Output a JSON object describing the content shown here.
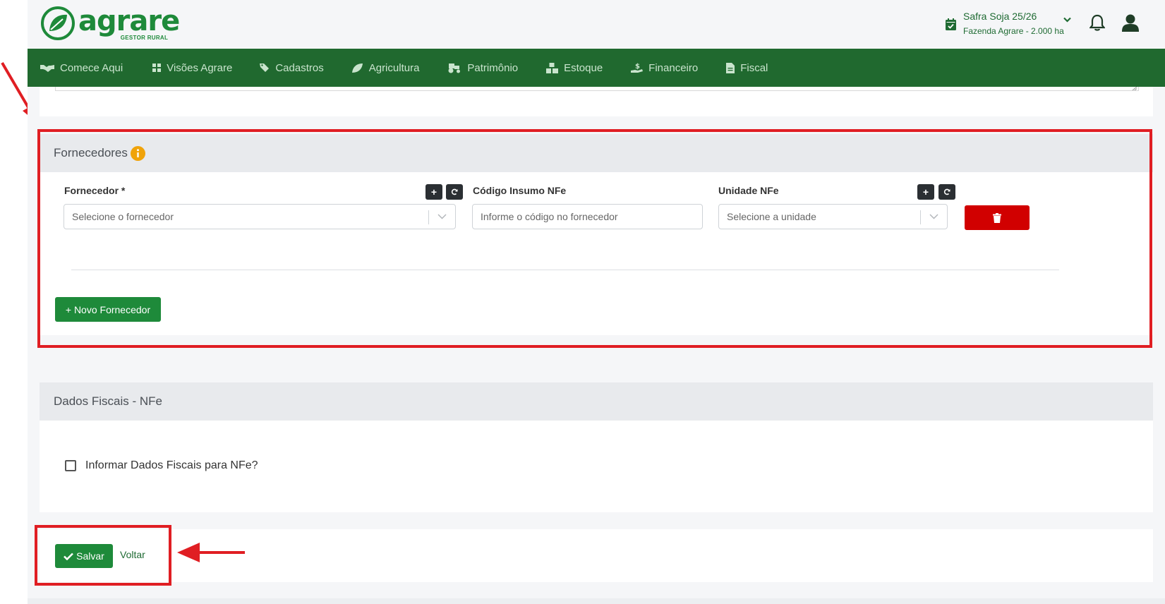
{
  "header": {
    "brand": {
      "name": "agrare",
      "tagline": "GESTOR RURAL",
      "icon": "leaf-logo-icon"
    },
    "season": {
      "title": "Safra Soja 25/26",
      "subtitle": "Fazenda Agrare - 2.000 ha",
      "icon": "calendar-check-icon"
    }
  },
  "nav": {
    "items": [
      {
        "label": "Comece Aqui",
        "icon": "handshake-icon"
      },
      {
        "label": "Visões Agrare",
        "icon": "grid-icon"
      },
      {
        "label": "Cadastros",
        "icon": "tags-icon"
      },
      {
        "label": "Agricultura",
        "icon": "leaf-icon"
      },
      {
        "label": "Patrimônio",
        "icon": "tractor-icon"
      },
      {
        "label": "Estoque",
        "icon": "boxes-icon"
      },
      {
        "label": "Financeiro",
        "icon": "hand-money-icon"
      },
      {
        "label": "Fiscal",
        "icon": "file-invoice-icon"
      }
    ]
  },
  "suppliers": {
    "title": "Fornecedores",
    "supplier_label": "Fornecedor *",
    "supplier_placeholder": "Selecione o fornecedor",
    "code_label": "Código Insumo NFe",
    "code_placeholder": "Informe o código no fornecedor",
    "unit_label": "Unidade NFe",
    "unit_placeholder": "Selecione a unidade",
    "add_symbol": "+",
    "new_supplier_button": "+ Novo Fornecedor"
  },
  "fiscal": {
    "title": "Dados Fiscais - NFe",
    "checkbox_label": "Informar Dados Fiscais para NFe?"
  },
  "actions": {
    "save_label": "Salvar",
    "back_label": "Voltar"
  },
  "colors": {
    "brand_green": "#1e8a3a",
    "nav_green": "#20692f",
    "danger": "#d10000",
    "annotation_red": "#e01e23",
    "info_orange": "#f0a30a"
  }
}
